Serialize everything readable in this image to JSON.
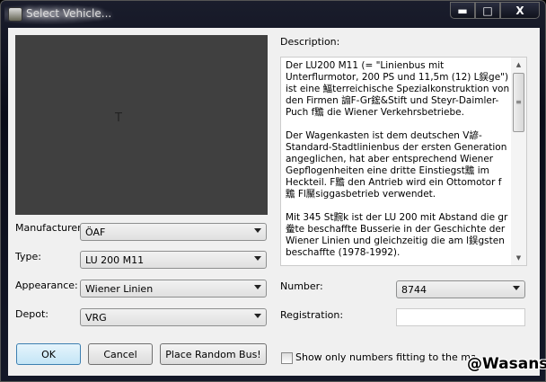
{
  "window": {
    "title": "Select Vehicle...",
    "controls": {
      "minimize": "▬",
      "maximize": "□",
      "close": "X"
    }
  },
  "preview": {
    "glyph": "T"
  },
  "fields": {
    "manufacturer": {
      "label": "Manufacturer:",
      "value": "ÖAF"
    },
    "type": {
      "label": "Type:",
      "value": "LU 200 M11"
    },
    "appearance": {
      "label": "Appearance:",
      "value": "Wiener Linien"
    },
    "depot": {
      "label": "Depot:",
      "value": "VRG"
    },
    "number": {
      "label": "Number:",
      "value": "8744"
    },
    "registration": {
      "label": "Registration:",
      "value": ""
    }
  },
  "description": {
    "label": "Description:",
    "text": "Der LU200 M11 (= \"Linienbus mit Unterflurmotor, 200 PS und 11,5m (12) L鋘ge\") ist eine 鰏terreichische Spezialkonstruktion von den Firmen 謆F-Gr鋐&Stift und Steyr-Daimler-Puch f黵 die Wiener Verkehrsbetriebe.\n\nDer Wagenkasten ist dem deutschen V諺-Standard-Stadtlinienbus der ersten Generation angeglichen, hat aber entsprechend Wiener Gepflogenheiten eine dritte Einstiegst黵 im Heckteil. F黵 den Antrieb wird ein Ottomotor f黵 Fl黶siggasbetrieb verwendet.\n\nMit 345 St黦k ist der LU 200 mit Abstand die gr鲞te beschaffte Busserie in der Geschichte der Wiener Linien und gleichzeitig die am l鋘gsten beschaffte (1978-1992)."
  },
  "buttons": {
    "ok": "OK",
    "cancel": "Cancel",
    "random": "Place Random Bus!"
  },
  "checkbox": {
    "label": "Show only numbers fitting to the map's depot",
    "checked": false
  },
  "watermark": "@Wasans"
}
